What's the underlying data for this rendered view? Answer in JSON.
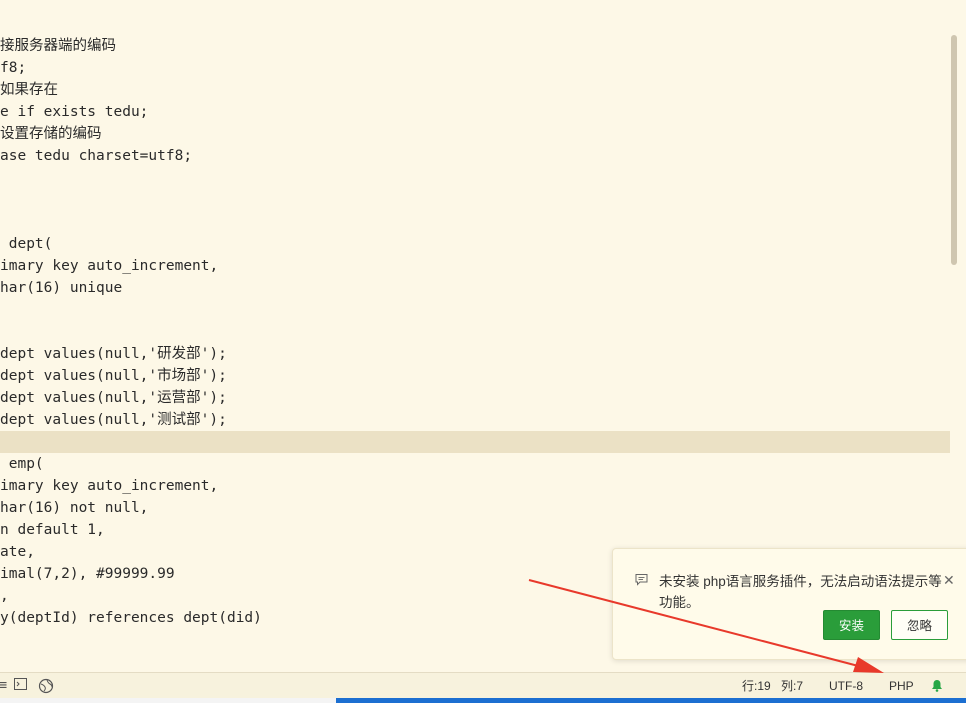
{
  "editor": {
    "lines": [
      {
        "text": "接服务器端的编码"
      },
      {
        "text": "f8;"
      },
      {
        "text": "如果存在"
      },
      {
        "text": "e if exists tedu;"
      },
      {
        "text": "设置存储的编码"
      },
      {
        "text": "ase tedu charset=utf8;"
      },
      {
        "text": ""
      },
      {
        "text": ""
      },
      {
        "text": ""
      },
      {
        "text": " dept("
      },
      {
        "text": "imary key auto_increment,"
      },
      {
        "text": "har(16) unique"
      },
      {
        "text": ""
      },
      {
        "text": ""
      },
      {
        "text": "dept values(null,'研发部');"
      },
      {
        "text": "dept values(null,'市场部');"
      },
      {
        "text": "dept values(null,'运营部');"
      },
      {
        "text": "dept values(null,'测试部');"
      },
      {
        "text": ""
      },
      {
        "text": " emp("
      },
      {
        "text": "imary key auto_increment,"
      },
      {
        "text": "har(16) not null,"
      },
      {
        "text": "n default 1,"
      },
      {
        "text": "ate,"
      },
      {
        "text": "imal(7,2), #99999.99"
      },
      {
        "text": ","
      },
      {
        "text": "y(deptId) references dept(did)"
      },
      {
        "text": ""
      },
      {
        "text": ""
      }
    ],
    "current_line_index": 18
  },
  "statusbar": {
    "left_icons": [
      "menu-icon",
      "terminal-icon",
      "globe-icon"
    ],
    "line_label": "行:19",
    "col_label": "列:7",
    "encoding": "UTF-8",
    "language": "PHP",
    "bell_icon": "bell-icon"
  },
  "notification": {
    "icon": "comment-icon",
    "message": "未安装 php语言服务插件，无法启动语法提示等功能。",
    "install_label": "安装",
    "ignore_label": "忽略",
    "close_icon": "close-icon"
  },
  "colors": {
    "editor_bg": "#fdf8e7",
    "current_line_bg": "#ebe1c5",
    "accent_green": "#2a9d3a",
    "arrow_red": "#e8392b",
    "taskbar_blue": "#1c6fd1"
  }
}
